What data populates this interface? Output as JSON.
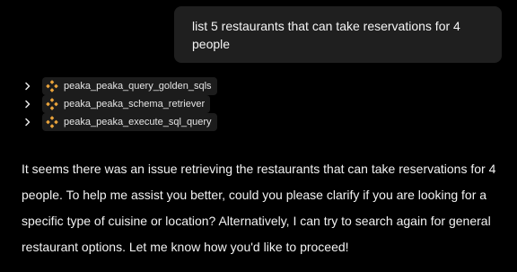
{
  "user_message": {
    "text": "list 5 restaurants that can take reservations for 4 people"
  },
  "tool_calls": [
    {
      "name": "peaka_peaka_query_golden_sqls",
      "icon": "peaka-logo-icon"
    },
    {
      "name": "peaka_peaka_schema_retriever",
      "icon": "peaka-logo-icon"
    },
    {
      "name": "peaka_peaka_execute_sql_query",
      "icon": "peaka-logo-icon"
    }
  ],
  "assistant_message": {
    "text": "It seems there was an issue retrieving the restaurants that can take reservations for 4 people. To help me assist you better, could you please clarify if you are looking for a specific type of cuisine or location? Alternatively, I can try to search again for general restaurant options. Let me know how you'd like to proceed!"
  },
  "colors": {
    "background": "#000000",
    "bubble": "#1f1f1f",
    "chip": "#1c1c1c",
    "tool_icon": "#e8a23a",
    "text": "#f2f2f2"
  }
}
